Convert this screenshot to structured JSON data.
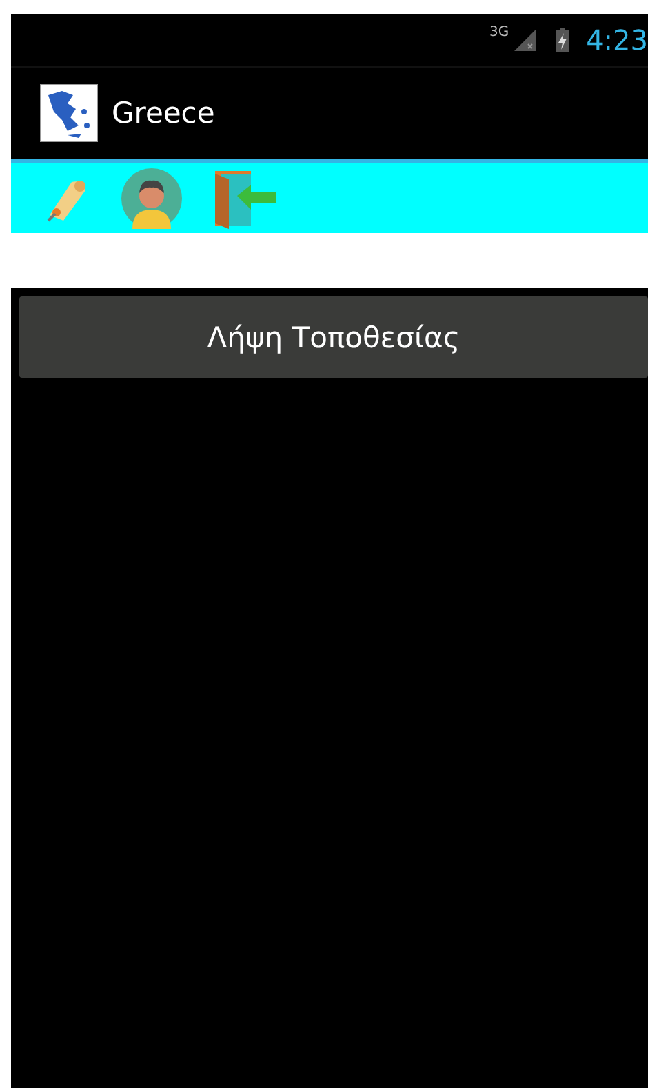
{
  "status_bar": {
    "network": "3G",
    "time": "4:23"
  },
  "action_bar": {
    "title": "Greece"
  },
  "main_button": {
    "label": "Λήψη Τοποθεσίας"
  }
}
